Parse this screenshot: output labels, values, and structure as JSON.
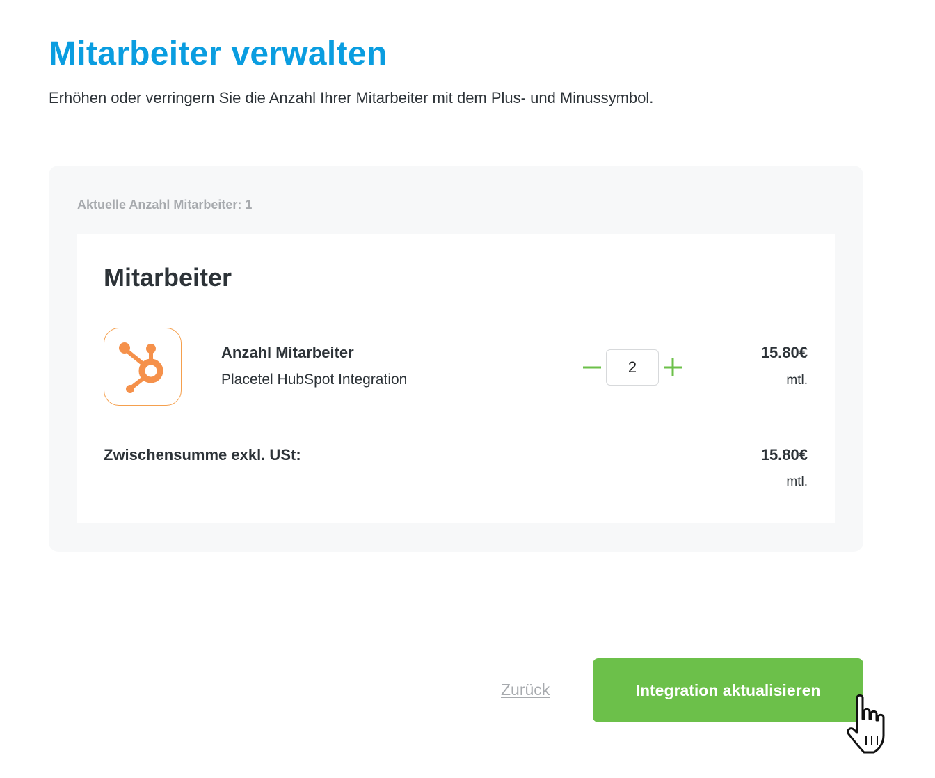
{
  "header": {
    "title": "Mitarbeiter verwalten",
    "subtitle": "Erhöhen oder verringern Sie die Anzahl Ihrer Mitarbeiter mit dem Plus- und Minussymbol."
  },
  "panel": {
    "current_count_label": "Aktuelle Anzahl Mitarbeiter: 1",
    "card": {
      "title": "Mitarbeiter",
      "product": {
        "logo_icon": "hubspot-sprocket-icon",
        "name": "Anzahl Mitarbeiter",
        "description": "Placetel HubSpot Integration",
        "quantity": "2",
        "price": "15.80€",
        "price_unit": "mtl."
      },
      "subtotal": {
        "label": "Zwischensumme exkl. USt:",
        "price": "15.80€",
        "price_unit": "mtl."
      }
    }
  },
  "footer": {
    "back_label": "Zurück",
    "primary_label": "Integration aktualisieren"
  },
  "colors": {
    "title_blue": "#0a9de0",
    "accent_green": "#6cc04a",
    "hubspot_orange": "#f5914b",
    "muted_gray": "#a7aaae"
  }
}
